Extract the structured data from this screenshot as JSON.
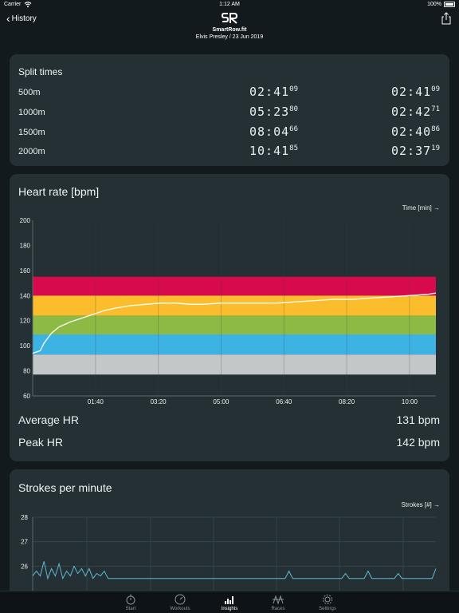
{
  "status": {
    "carrier": "Carrier",
    "time": "1:12 AM",
    "battery": "100%"
  },
  "nav": {
    "back_label": "History",
    "app_name": "SmartRow.fit",
    "subtitle": "Elvis Presley / 23 Jun 2019"
  },
  "splits": {
    "title": "Split times",
    "rows": [
      {
        "distance": "500m",
        "cum_main": "02:41",
        "cum_frac": "09",
        "split_main": "02:41",
        "split_frac": "09"
      },
      {
        "distance": "1000m",
        "cum_main": "05:23",
        "cum_frac": "80",
        "split_main": "02:42",
        "split_frac": "71"
      },
      {
        "distance": "1500m",
        "cum_main": "08:04",
        "cum_frac": "66",
        "split_main": "02:40",
        "split_frac": "86"
      },
      {
        "distance": "2000m",
        "cum_main": "10:41",
        "cum_frac": "85",
        "split_main": "02:37",
        "split_frac": "19"
      }
    ]
  },
  "heart_rate": {
    "title": "Heart rate [bpm]",
    "axis_hint": "Time [min]",
    "avg_label": "Average HR",
    "avg_value": "131 bpm",
    "peak_label": "Peak HR",
    "peak_value": "142 bpm"
  },
  "strokes": {
    "title": "Strokes per minute",
    "axis_hint": "Strokes [#]"
  },
  "chart_data": [
    {
      "type": "line",
      "title": "Heart rate [bpm]",
      "xlabel": "Time [min]",
      "ylabel": "",
      "ylim": [
        60,
        200
      ],
      "xlim": [
        0,
        10.7
      ],
      "y_ticks": [
        60,
        80,
        100,
        120,
        140,
        160,
        180,
        200
      ],
      "x_ticks": [
        {
          "value": 1.667,
          "label": "01:40"
        },
        {
          "value": 3.333,
          "label": "03:20"
        },
        {
          "value": 5.0,
          "label": "05:00"
        },
        {
          "value": 6.667,
          "label": "06:40"
        },
        {
          "value": 8.333,
          "label": "08:20"
        },
        {
          "value": 10.0,
          "label": "10:00"
        }
      ],
      "zones": [
        {
          "from": 77,
          "to": 93,
          "color": "#c4c7c7"
        },
        {
          "from": 93,
          "to": 109,
          "color": "#3cb3e3"
        },
        {
          "from": 109,
          "to": 124,
          "color": "#8cba44"
        },
        {
          "from": 124,
          "to": 140,
          "color": "#fcbd2c"
        },
        {
          "from": 140,
          "to": 155,
          "color": "#d80a4e"
        }
      ],
      "series": [
        {
          "color": "#ffffff",
          "x": [
            0,
            0.2,
            0.3,
            0.5,
            0.7,
            1.0,
            1.3,
            1.6,
            1.9,
            2.2,
            2.6,
            3.0,
            3.4,
            3.8,
            4.2,
            4.5,
            5.0,
            5.5,
            6.0,
            6.5,
            7.0,
            7.5,
            8.0,
            8.5,
            9.0,
            9.5,
            10.0,
            10.5,
            10.7
          ],
          "y": [
            94,
            96,
            102,
            110,
            115,
            119,
            122,
            125,
            128,
            130,
            132,
            133,
            134,
            134,
            133,
            133,
            134,
            134,
            134,
            134,
            135,
            136,
            137,
            137,
            138,
            139,
            140,
            141,
            142
          ]
        }
      ]
    },
    {
      "type": "line",
      "title": "Strokes per minute",
      "xlabel": "Strokes [#]",
      "ylabel": "",
      "ylim": [
        25,
        28
      ],
      "y_ticks": [
        26,
        27,
        28
      ],
      "series": [
        {
          "color": "#5fb8d6",
          "x": [
            0,
            0.1,
            0.2,
            0.3,
            0.4,
            0.5,
            0.6,
            0.7,
            0.8,
            0.9,
            1.0,
            1.1,
            1.2,
            1.3,
            1.4,
            1.5,
            1.6,
            1.7,
            1.8,
            1.9,
            2.0,
            6.7,
            6.8,
            6.9,
            8.2,
            8.3,
            8.4,
            8.8,
            8.9,
            9.0,
            9.6,
            9.7,
            9.8,
            10.6,
            10.7
          ],
          "y": [
            25.6,
            25.8,
            25.6,
            26.2,
            25.5,
            25.9,
            25.6,
            26.1,
            25.5,
            25.8,
            25.6,
            26.0,
            25.7,
            25.9,
            25.6,
            25.9,
            25.5,
            25.7,
            25.6,
            25.8,
            25.5,
            25.5,
            25.8,
            25.5,
            25.5,
            25.7,
            25.5,
            25.5,
            25.8,
            25.5,
            25.5,
            25.7,
            25.5,
            25.5,
            25.9
          ]
        }
      ]
    }
  ],
  "tabs": [
    {
      "label": "Start",
      "icon": "stopwatch-icon"
    },
    {
      "label": "Workouts",
      "icon": "gauge-icon"
    },
    {
      "label": "Insights",
      "icon": "bar-chart-icon",
      "active": true
    },
    {
      "label": "Races",
      "icon": "flag-icon"
    },
    {
      "label": "Settings",
      "icon": "gear-icon"
    }
  ]
}
